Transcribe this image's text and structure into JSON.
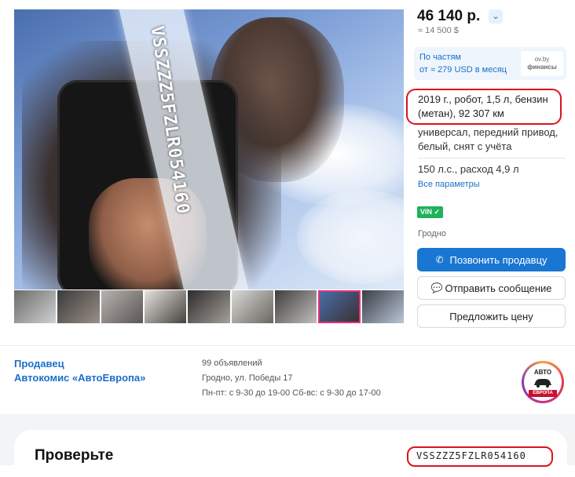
{
  "listing": {
    "photo_vin_text": "VSSZZZ5FZLR054160",
    "thumbnail_count": 9,
    "active_thumbnail_index": 7
  },
  "price": {
    "byn": "46 140 р.",
    "usd": "≈ 14 500 $"
  },
  "credit": {
    "line1": "По частям",
    "line2": "от ≈ 279 USD в месяц",
    "partner_line1": "ov.by",
    "partner_line2": "финансы"
  },
  "specs": {
    "main": "2019 г., робот, 1,5 л, бензин (метан), 92 307 км",
    "body": "универсал, передний привод, белый, снят с учёта",
    "engine": "150 л.с., расход 4,9 л",
    "all_params_link": "Все параметры",
    "vin_badge": "VIN ✓",
    "city": "Гродно"
  },
  "actions": {
    "call": "Позвонить продавцу",
    "message": "Отправить сообщение",
    "offer": "Предложить цену"
  },
  "seller": {
    "title": "Продавец",
    "name": "Автокомис «АвтоЕвропа»",
    "ads": "99 объявлений",
    "address": "Гродно, ул. Победы 17",
    "hours": "Пн-пт: с 9-30 до 19-00 Сб-вс: с 9-30 до 17-00",
    "logo_top": "АВТО",
    "logo_bottom": "ЕВРОПА"
  },
  "check": {
    "title": "Проверьте",
    "vin": "VSSZZZ5FZLR054160"
  },
  "colors": {
    "accent": "#1976d2",
    "link": "#1a6fc9",
    "highlight": "#d9141f",
    "vin_green": "#1fb25a"
  },
  "icons": {
    "price_dropdown": "chevron-down-icon",
    "call": "phone-icon",
    "message": "chat-icon"
  }
}
